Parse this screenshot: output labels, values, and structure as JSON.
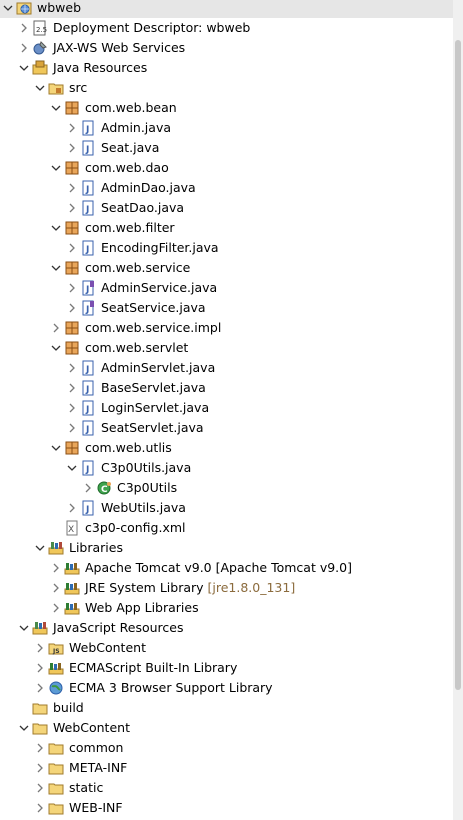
{
  "tree": [
    {
      "label": "wbweb",
      "icon": "web-project-icon",
      "level": 0,
      "expanded": true,
      "selected": true
    },
    {
      "label": "Deployment Descriptor: wbweb",
      "icon": "deployment-descriptor-icon",
      "level": 1,
      "expanded": false
    },
    {
      "label": "JAX-WS Web Services",
      "icon": "web-services-icon",
      "level": 1,
      "expanded": false
    },
    {
      "label": "Java Resources",
      "icon": "java-resources-icon",
      "level": 1,
      "expanded": true
    },
    {
      "label": "src",
      "icon": "source-folder-icon",
      "level": 2,
      "expanded": true
    },
    {
      "label": "com.web.bean",
      "icon": "package-icon",
      "level": 3,
      "expanded": true
    },
    {
      "label": "Admin.java",
      "icon": "java-file-icon",
      "level": 4,
      "expanded": false
    },
    {
      "label": "Seat.java",
      "icon": "java-file-icon",
      "level": 4,
      "expanded": false
    },
    {
      "label": "com.web.dao",
      "icon": "package-icon",
      "level": 3,
      "expanded": true
    },
    {
      "label": "AdminDao.java",
      "icon": "java-file-icon",
      "level": 4,
      "expanded": false
    },
    {
      "label": "SeatDao.java",
      "icon": "java-file-icon",
      "level": 4,
      "expanded": false
    },
    {
      "label": "com.web.filter",
      "icon": "package-icon",
      "level": 3,
      "expanded": true
    },
    {
      "label": "EncodingFilter.java",
      "icon": "java-file-icon",
      "level": 4,
      "expanded": false
    },
    {
      "label": "com.web.service",
      "icon": "package-icon",
      "level": 3,
      "expanded": true
    },
    {
      "label": "AdminService.java",
      "icon": "java-interface-icon",
      "level": 4,
      "expanded": false
    },
    {
      "label": "SeatService.java",
      "icon": "java-interface-icon",
      "level": 4,
      "expanded": false
    },
    {
      "label": "com.web.service.impl",
      "icon": "package-icon",
      "level": 3,
      "expanded": false
    },
    {
      "label": "com.web.servlet",
      "icon": "package-icon",
      "level": 3,
      "expanded": true
    },
    {
      "label": "AdminServlet.java",
      "icon": "java-file-icon",
      "level": 4,
      "expanded": false
    },
    {
      "label": "BaseServlet.java",
      "icon": "java-file-icon",
      "level": 4,
      "expanded": false
    },
    {
      "label": "LoginServlet.java",
      "icon": "java-file-icon",
      "level": 4,
      "expanded": false
    },
    {
      "label": "SeatServlet.java",
      "icon": "java-file-icon",
      "level": 4,
      "expanded": false
    },
    {
      "label": "com.web.utlis",
      "icon": "package-icon",
      "level": 3,
      "expanded": true
    },
    {
      "label": "C3p0Utils.java",
      "icon": "java-file-icon",
      "level": 4,
      "expanded": true
    },
    {
      "label": "C3p0Utils",
      "icon": "java-class-icon",
      "level": 5,
      "expanded": false
    },
    {
      "label": "WebUtils.java",
      "icon": "java-file-icon",
      "level": 4,
      "expanded": false
    },
    {
      "label": "c3p0-config.xml",
      "icon": "xml-file-icon",
      "level": 3,
      "leaf": true
    },
    {
      "label": "Libraries",
      "icon": "libraries-icon",
      "level": 2,
      "expanded": true
    },
    {
      "label": "Apache Tomcat v9.0 [Apache Tomcat v9.0]",
      "icon": "library-icon",
      "level": 3,
      "expanded": false
    },
    {
      "label": "JRE System Library",
      "decoration": "[jre1.8.0_131]",
      "icon": "library-icon",
      "level": 3,
      "expanded": false
    },
    {
      "label": "Web App Libraries",
      "icon": "library-icon",
      "level": 3,
      "expanded": false
    },
    {
      "label": "JavaScript Resources",
      "icon": "libraries-icon",
      "level": 1,
      "expanded": true
    },
    {
      "label": "WebContent",
      "icon": "js-folder-icon",
      "level": 2,
      "expanded": false
    },
    {
      "label": "ECMAScript Built-In Library",
      "icon": "library-icon",
      "level": 2,
      "expanded": false
    },
    {
      "label": "ECMA 3 Browser Support Library",
      "icon": "globe-icon",
      "level": 2,
      "expanded": false
    },
    {
      "label": "build",
      "icon": "folder-icon",
      "level": 1,
      "leaf": true
    },
    {
      "label": "WebContent",
      "icon": "folder-icon",
      "level": 1,
      "expanded": true
    },
    {
      "label": "common",
      "icon": "folder-icon",
      "level": 2,
      "expanded": false
    },
    {
      "label": "META-INF",
      "icon": "folder-icon",
      "level": 2,
      "expanded": false
    },
    {
      "label": "static",
      "icon": "folder-icon",
      "level": 2,
      "expanded": false
    },
    {
      "label": "WEB-INF",
      "icon": "folder-icon",
      "level": 2,
      "expanded": false
    }
  ],
  "colors": {
    "selection": "#e6e6e6",
    "decoration": "#8b6b3d",
    "arrow": "#7a7a7a",
    "package": "#b5651d",
    "java_blue": "#3a62ad",
    "folder": "#e8b84a",
    "library_green": "#2e7d32"
  }
}
